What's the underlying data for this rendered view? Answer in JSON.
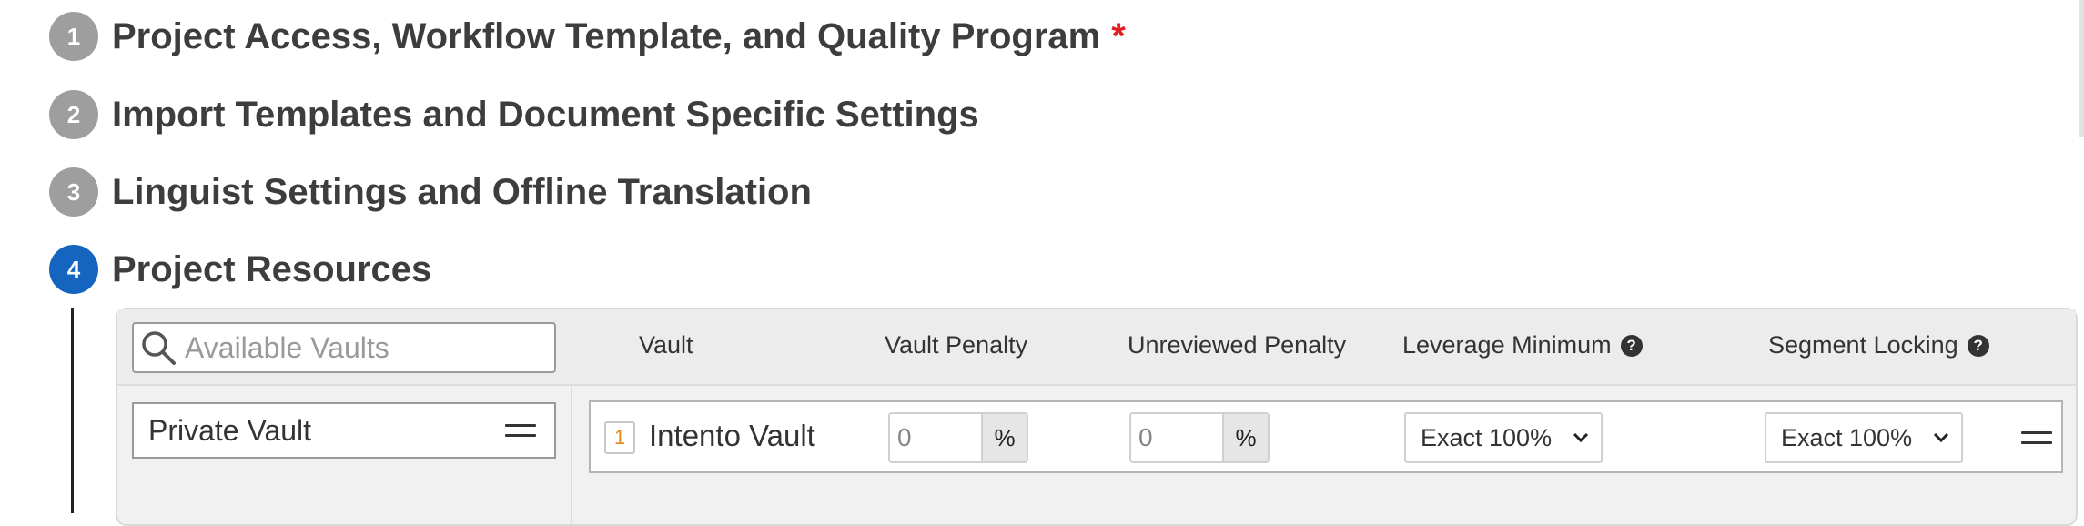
{
  "steps": [
    {
      "num": "1",
      "title": "Project Access, Workflow Template, and Quality Program",
      "required_mark": "*"
    },
    {
      "num": "2",
      "title": "Import Templates and Document Specific Settings"
    },
    {
      "num": "3",
      "title": "Linguist Settings and Offline Translation"
    },
    {
      "num": "4",
      "title": "Project Resources"
    }
  ],
  "resources": {
    "search": {
      "placeholder": "Available Vaults",
      "value": ""
    },
    "available_vaults": [
      {
        "label": "Private Vault"
      }
    ],
    "columns": {
      "vault": "Vault",
      "vault_penalty": "Vault Penalty",
      "unreviewed_penalty": "Unreviewed Penalty",
      "leverage_minimum": "Leverage Minimum",
      "segment_locking": "Segment Locking"
    },
    "help_glyph": "?",
    "rows": [
      {
        "rank": "1",
        "vault": "Intento Vault",
        "vault_penalty": "0",
        "unreviewed_penalty": "0",
        "percent_symbol": "%",
        "leverage_minimum": "Exact 100%",
        "segment_locking": "Exact 100%"
      }
    ]
  },
  "colors": {
    "active_step": "#1565c0",
    "inactive_step": "#9e9e9e",
    "required": "#e02020",
    "rank_number": "#e38a18"
  }
}
